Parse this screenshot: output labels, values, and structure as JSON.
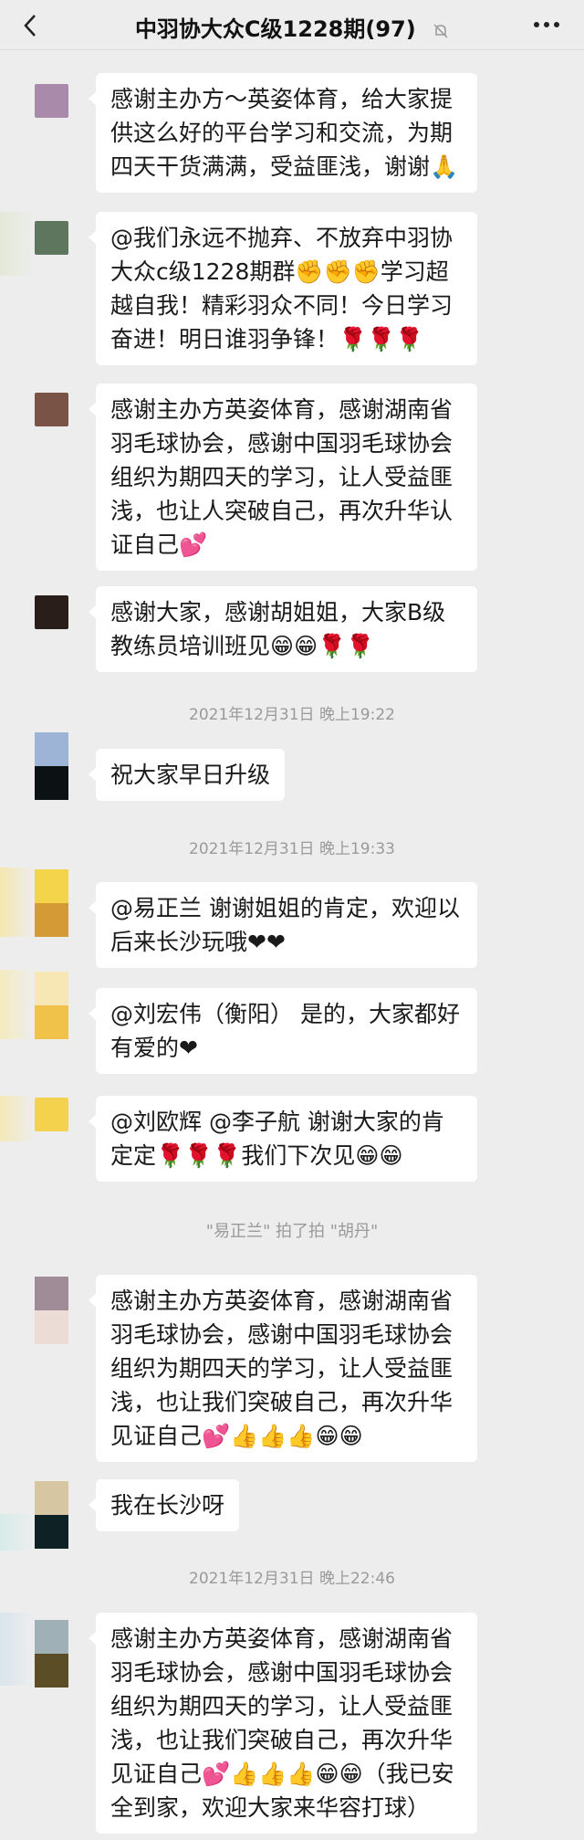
{
  "header": {
    "back_icon": "chevron-left-icon",
    "title": "中羽协大众C级1228期(97)",
    "mute_icon": "bell-off-icon",
    "more_icon": "more-icon"
  },
  "messages": [
    {
      "text": "感谢主办方～英姿体育，给大家提供这么好的平台学习和交流，为期四天干货满满，受益匪浅，谢谢🙏",
      "avatar_color": "#a98aaa"
    },
    {
      "text": "@我们永远不抛弃、不放弃中羽协大众c级1228期群✊✊✊学习超越自我！精彩羽众不同！今日学习奋进！明日谁羽争锋！🌹🌹🌹",
      "avatar_color": "#5f765e"
    },
    {
      "text": "感谢主办方英姿体育，感谢湖南省羽毛球协会，感谢中国羽毛球协会组织为期四天的学习，让人受益匪浅，也让人突破自己，再次升华认证自己💕",
      "avatar_color": "#7a5347"
    },
    {
      "text": "感谢大家，感谢胡姐姐，大家B级教练员培训班见😁😁🌹🌹",
      "avatar_color": "#2a1e1a"
    },
    {
      "time": "2021年12月31日 晚上19:22"
    },
    {
      "text": "祝大家早日升级",
      "avatar_top": "#9db4d6",
      "avatar_bottom": "#0c1114"
    },
    {
      "time": "2021年12月31日 晚上19:33"
    },
    {
      "text": "@易正兰  谢谢姐姐的肯定，欢迎以后来长沙玩哦❤❤",
      "avatar_top": "#f4d44b",
      "avatar_bottom": "#d49a36"
    },
    {
      "text": "@刘宏伟（衡阳）  是的，大家都好有爱的❤",
      "avatar_top": "#f6e7b4",
      "avatar_bottom": "#f0c24a"
    },
    {
      "text": "@刘欧辉  @李子航  谢谢大家的肯定定🌹🌹🌹我们下次见😁😁",
      "avatar_color": "#f5d24d"
    },
    {
      "pat": "\"易正兰\" 拍了拍 \"胡丹\""
    },
    {
      "text": "感谢主办方英姿体育，感谢湖南省羽毛球协会，感谢中国羽毛球协会组织为期四天的学习，让人受益匪浅，也让我们突破自己，再次升华见证自己💕👍👍👍😁😁",
      "avatar_top": "#a08c96",
      "avatar_bottom": "#ecdcd6"
    },
    {
      "text": "我在长沙呀",
      "avatar_top": "#d6c6a2",
      "avatar_bottom": "#0e2226"
    },
    {
      "time": "2021年12月31日 晚上22:46"
    },
    {
      "text": "感谢主办方英姿体育，感谢湖南省羽毛球协会，感谢中国羽毛球协会组织为期四天的学习，让人受益匪浅，也让我们突破自己，再次升华见证自己💕👍👍👍😁😁（我已安全到家，欢迎大家来华容打球）",
      "avatar_top": "#9fb0b6",
      "avatar_bottom": "#5b4e26"
    }
  ]
}
